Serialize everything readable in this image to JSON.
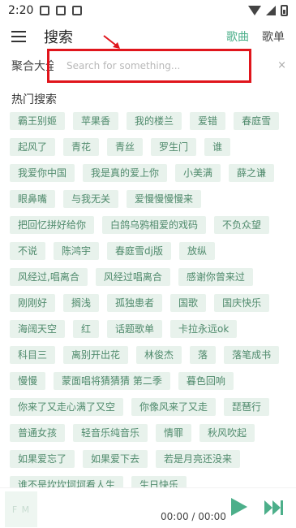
{
  "status_bar": {
    "time": "2:20"
  },
  "header": {
    "title": "搜索",
    "tabs": [
      {
        "label": "歌曲",
        "active": true
      },
      {
        "label": "歌单",
        "active": false
      }
    ]
  },
  "search": {
    "source_label": "聚合大全",
    "placeholder": "Search for something...",
    "clear_symbol": "×"
  },
  "hot_search": {
    "title": "热门搜索",
    "rows": [
      [
        "霸王别姬",
        "苹果香",
        "我的楼兰",
        "爱错",
        "春庭雪"
      ],
      [
        "起风了",
        "青花",
        "青丝",
        "罗生门",
        "谁"
      ],
      [
        "我爱你中国",
        "我是真的爱上你",
        "小美满",
        "薛之谦"
      ],
      [
        "眼鼻嘴",
        "与我无关",
        "爱慢慢慢慢来"
      ],
      [
        "把回忆拼好给你",
        "白鸽乌鸦相爱的戏码",
        "不负众望"
      ],
      [
        "不说",
        "陈鸿宇",
        "春庭雪dj版",
        "放纵"
      ],
      [
        "风经过,唱离合",
        "风经过唱离合",
        "感谢你曾来过"
      ],
      [
        "刚刚好",
        "搁浅",
        "孤独患者",
        "国歌",
        "国庆快乐"
      ],
      [
        "海阔天空",
        "红",
        "话题歌单",
        "卡拉永远ok"
      ],
      [
        "科目三",
        "离别开出花",
        "林俊杰",
        "落",
        "落笔成书"
      ],
      [
        "慢慢",
        "蒙面唱将猜猜猜 第二季",
        "暮色回响"
      ],
      [
        "你来了又走心满了又空",
        "你像风来了又走",
        "琵琶行"
      ],
      [
        "普通女孩",
        "轻音乐纯音乐",
        "情罪",
        "秋风吹起"
      ],
      [
        "如果爱忘了",
        "如果爱下去",
        "若是月亮还没来"
      ],
      [
        "谁不是坎坎坷坷看人生",
        "生日快乐"
      ]
    ]
  },
  "player": {
    "cover_text": "F M",
    "time": "00:00 / 00:00"
  },
  "colors": {
    "accent": "#4caf8a",
    "tag_bg": "#e8f2ec",
    "tag_text": "#4f8a6c",
    "highlight": "#e0151c"
  }
}
